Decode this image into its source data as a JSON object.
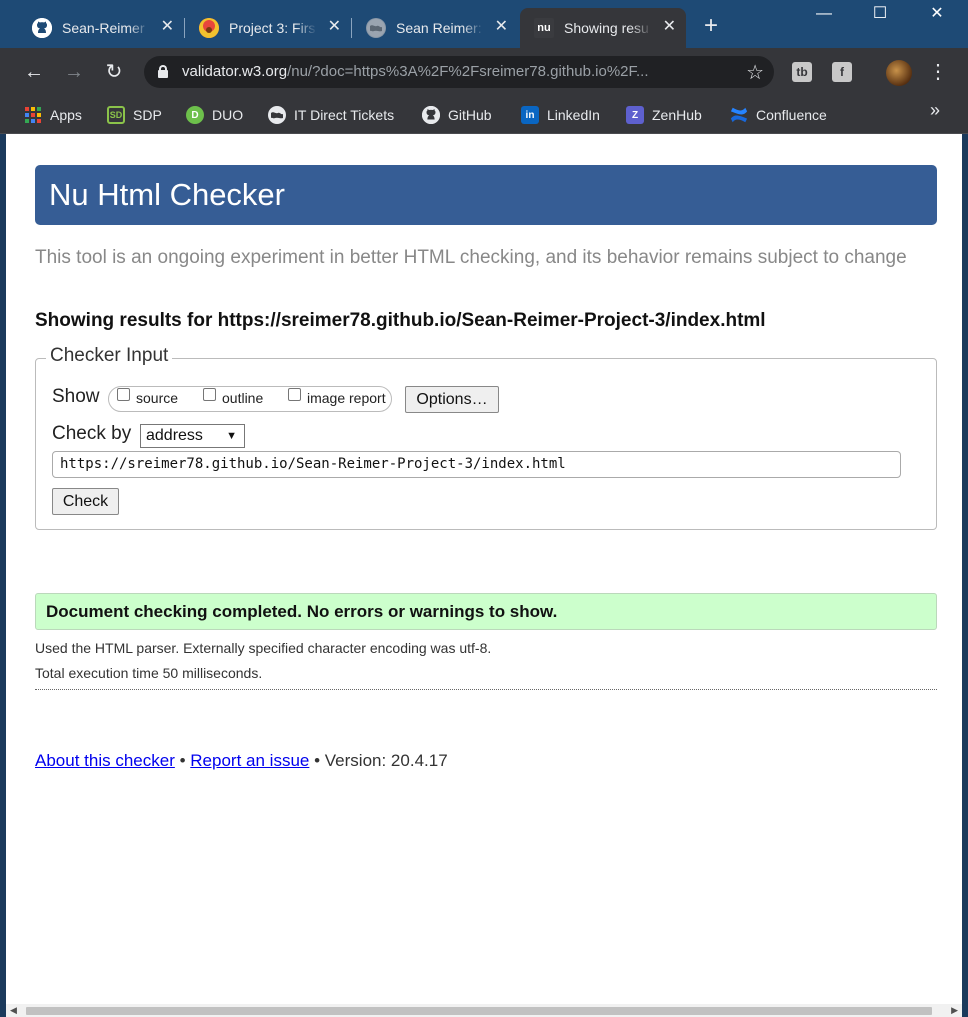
{
  "browser": {
    "tabs": [
      {
        "title": "Sean-Reimer",
        "icon": "github-icon",
        "active": false
      },
      {
        "title": "Project 3: Firs",
        "icon": "project-icon",
        "active": false
      },
      {
        "title": "Sean Reimer:",
        "icon": "globe-icon",
        "active": false
      },
      {
        "title": "Showing resu",
        "icon": "nu-icon",
        "favicon_text": "nu",
        "active": true
      }
    ],
    "new_tab_label": "+",
    "window_controls": {
      "minimize": "—",
      "maximize": "☐",
      "close": "✕"
    },
    "address": {
      "domain": "validator.w3.org",
      "rest": "/nu/?doc=https%3A%2F%2Fsreimer78.github.io%2F..."
    },
    "extensions": [
      {
        "name": "tb-extension-icon",
        "label": "tb"
      },
      {
        "name": "facebook-extension-icon",
        "label": "f"
      }
    ],
    "bookmarks": [
      {
        "label": "Apps",
        "icon": "apps-grid-icon"
      },
      {
        "label": "SDP",
        "icon": "sdp-icon",
        "glyph": "SD"
      },
      {
        "label": "DUO",
        "icon": "duo-icon",
        "glyph": "D"
      },
      {
        "label": "IT Direct Tickets",
        "icon": "globe-icon",
        "glyph": ""
      },
      {
        "label": "GitHub",
        "icon": "github-icon",
        "glyph": ""
      },
      {
        "label": "LinkedIn",
        "icon": "linkedin-icon",
        "glyph": "in"
      },
      {
        "label": "ZenHub",
        "icon": "zenhub-icon",
        "glyph": "Z"
      },
      {
        "label": "Confluence",
        "icon": "confluence-icon",
        "glyph": ""
      }
    ],
    "bookmarks_more": "»"
  },
  "page": {
    "header_title": "Nu Html Checker",
    "intro": "This tool is an ongoing experiment in better HTML checking, and its behavior remains subject to change",
    "results_for": "Showing results for https://sreimer78.github.io/Sean-Reimer-Project-3/index.html",
    "checker": {
      "legend": "Checker Input",
      "show_label": "Show",
      "show_options": [
        {
          "label": "source",
          "checked": false
        },
        {
          "label": "outline",
          "checked": false
        },
        {
          "label": "image report",
          "checked": false
        }
      ],
      "options_button": "Options…",
      "check_by_label": "Check by",
      "check_by_value": "address",
      "url_value": "https://sreimer78.github.io/Sean-Reimer-Project-3/index.html",
      "check_button": "Check"
    },
    "success_message": "Document checking completed. No errors or warnings to show.",
    "parser_note": "Used the HTML parser. Externally specified character encoding was utf-8.",
    "exec_time": "Total execution time 50 milliseconds.",
    "footer": {
      "about_link": "About this checker",
      "separator": "•",
      "report_link": "Report an issue",
      "version": "Version: 20.4.17"
    }
  },
  "colors": {
    "header_bar": "#365d95",
    "success_bg": "#ccffcc",
    "titlebar": "#1e4a75",
    "toolbar": "#35363a"
  }
}
